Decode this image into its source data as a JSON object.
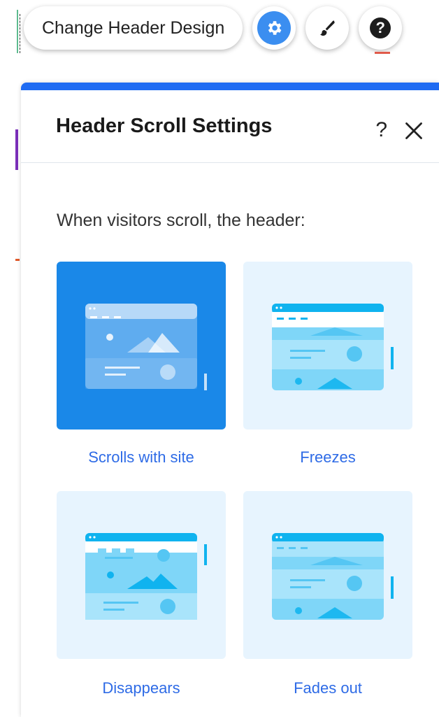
{
  "toolbar": {
    "change_header_label": "Change Header Design",
    "settings_icon": "gear-icon",
    "design_icon": "paintbrush-icon",
    "help_icon": "question-icon",
    "help_glyph": "?"
  },
  "panel": {
    "title": "Header Scroll Settings",
    "help_glyph": "?",
    "close_icon": "close-icon",
    "subtitle": "When visitors scroll, the header:",
    "options": [
      {
        "label": "Scrolls with site",
        "selected": true
      },
      {
        "label": "Freezes",
        "selected": false
      },
      {
        "label": "Disappears",
        "selected": false
      },
      {
        "label": "Fades out",
        "selected": false
      }
    ]
  },
  "colors": {
    "accent": "#1f6bf2",
    "selected_tile": "#1a88e8",
    "tile_bg": "#e7f4fe",
    "label_link": "#2e6be6"
  }
}
